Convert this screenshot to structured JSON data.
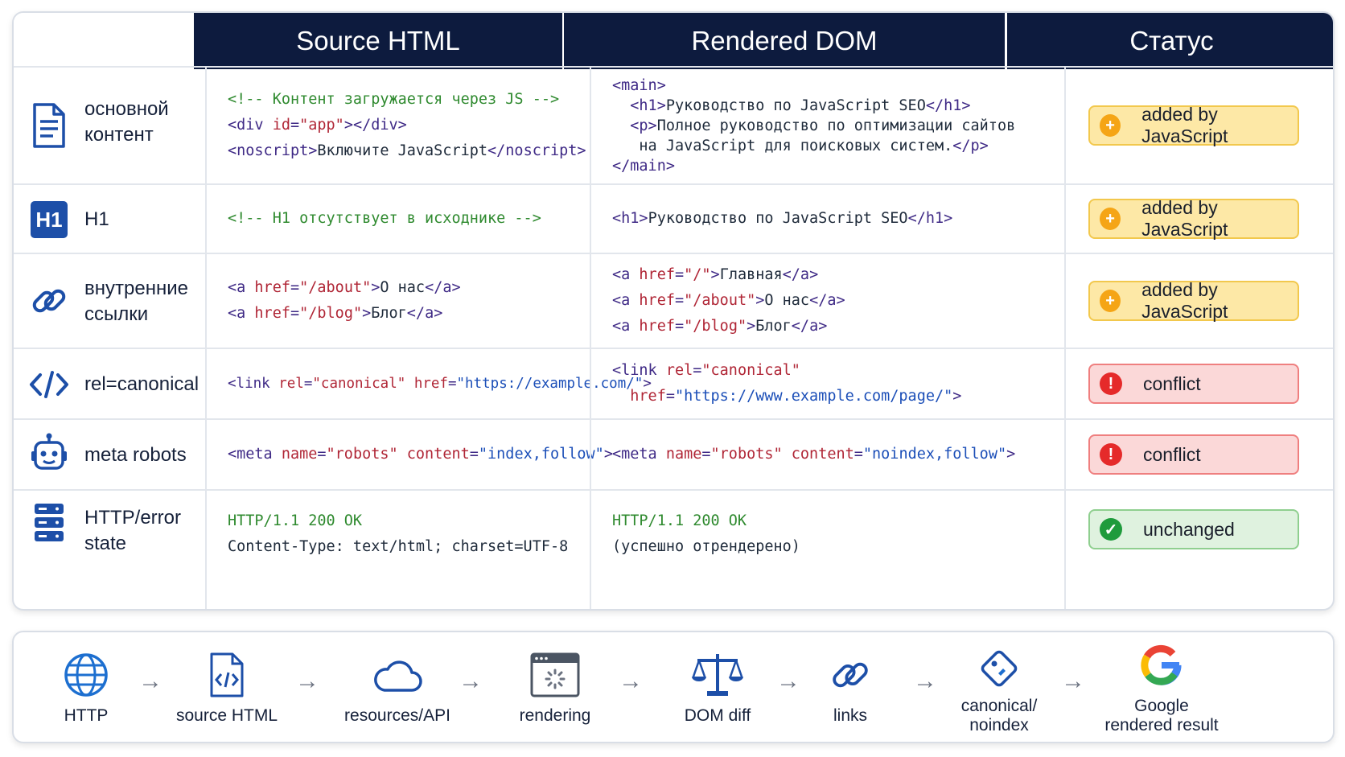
{
  "headers": {
    "source": "Source HTML",
    "rendered": "Rendered DOM",
    "status": "Статус"
  },
  "rows": [
    {
      "label_line1": "основной",
      "label_line2": "контент",
      "icon": "document-icon",
      "source": {
        "l1": "<!-- Контент загружается через JS -->",
        "l2a": "<div ",
        "l2b": "id",
        "l2c": "=",
        "l2d": "\"app\"",
        "l2e": "></div>",
        "l3a": "<noscript>",
        "l3b": "Включите JavaScript",
        "l3c": "</noscript>"
      },
      "dom": {
        "l1": "<main>",
        "l2a": "  <h1>",
        "l2b": "Руководство по JavaScript SEO",
        "l2c": "</h1>",
        "l3a": "  <p>",
        "l3b": "Полное руководство по оптимизации сайтов",
        "l4a": "   на JavaScript для поисковых систем.",
        "l4b": "</p>",
        "l5": "</main>"
      },
      "status": "added by JavaScript",
      "status_kind": "added"
    },
    {
      "label": "H1",
      "icon_text": "H1",
      "icon": "h1-icon",
      "source": {
        "l1": "<!-- H1 отсутствует в исходнике -->"
      },
      "dom": {
        "l1a": "<h1>",
        "l1b": "Руководство по JavaScript SEO",
        "l1c": "</h1>"
      },
      "status": "added by JavaScript",
      "status_kind": "added"
    },
    {
      "label_line1": "внутренние",
      "label_line2": "ссылки",
      "icon": "link-icon",
      "source": {
        "a": "<a ",
        "b": "href",
        "c": "=",
        "d1": "\"/about\"",
        "t1": "О нас",
        "d2": "\"/blog\"",
        "t2": "Блог",
        "close": "</a>",
        "gt": ">"
      },
      "dom": {
        "d0": "\"/\"",
        "t0": "Главная",
        "d1": "\"/about\"",
        "t1": "О нас",
        "d2": "\"/blog\"",
        "t2": "Блог"
      },
      "status": "added by JavaScript",
      "status_kind": "added"
    },
    {
      "label": "rel=canonical",
      "icon": "code-icon",
      "source": {
        "a": "<link ",
        "b": "rel",
        "c": "=",
        "d": "\"canonical\"",
        "e": " href",
        "f": "=",
        "g": "\"https://example.com/\"",
        "h": ">"
      },
      "dom": {
        "a": "<link ",
        "b": "rel",
        "c": "=",
        "d": "\"canonical\"",
        "e": "  href",
        "f": "=",
        "g": "\"https://www.example.com/page/\"",
        "h": ">"
      },
      "status": "conflict",
      "status_kind": "conflict"
    },
    {
      "label": "meta robots",
      "icon": "robot-icon",
      "source": {
        "a": "<meta ",
        "b": "name",
        "c": "=",
        "d": "\"robots\"",
        "e": " content",
        "f": "=",
        "g": "\"index,follow\"",
        "h": ">"
      },
      "dom": {
        "a": "<meta ",
        "b": "name",
        "c": "=",
        "d": "\"robots\"",
        "e": " content",
        "f": "=",
        "g": "\"noindex,follow\"",
        "h": ">"
      },
      "status": "conflict",
      "status_kind": "conflict"
    },
    {
      "label_line1": "HTTP/error",
      "label_line2": "state",
      "icon": "server-icon",
      "source": {
        "l1": "HTTP/1.1 200 OK",
        "l2": "Content-Type: text/html; charset=UTF-8"
      },
      "dom": {
        "l1": "HTTP/1.1 200 OK",
        "l2": "(успешно отрендерено)"
      },
      "status": "unchanged",
      "status_kind": "unchanged"
    }
  ],
  "flow": [
    {
      "label": "HTTP",
      "icon": "globe-icon"
    },
    {
      "label": "source HTML",
      "icon": "html-file-icon"
    },
    {
      "label": "resources/API",
      "icon": "cloud-icon"
    },
    {
      "label": "rendering",
      "icon": "browser-loading-icon"
    },
    {
      "label": "DOM diff",
      "icon": "scales-icon"
    },
    {
      "label": "links",
      "icon": "link-icon"
    },
    {
      "label_line1": "canonical/",
      "label_line2": "noindex",
      "icon": "tag-icon"
    },
    {
      "label_line1": "Google",
      "label_line2": "rendered result",
      "icon": "google-icon"
    }
  ],
  "arrow": "→",
  "colors": {
    "header_bg": "#0d1b3e",
    "added": "#fde8a6",
    "conflict": "#fbd8d8",
    "unchanged": "#dff2df",
    "accent_blue": "#1d4fa8"
  }
}
